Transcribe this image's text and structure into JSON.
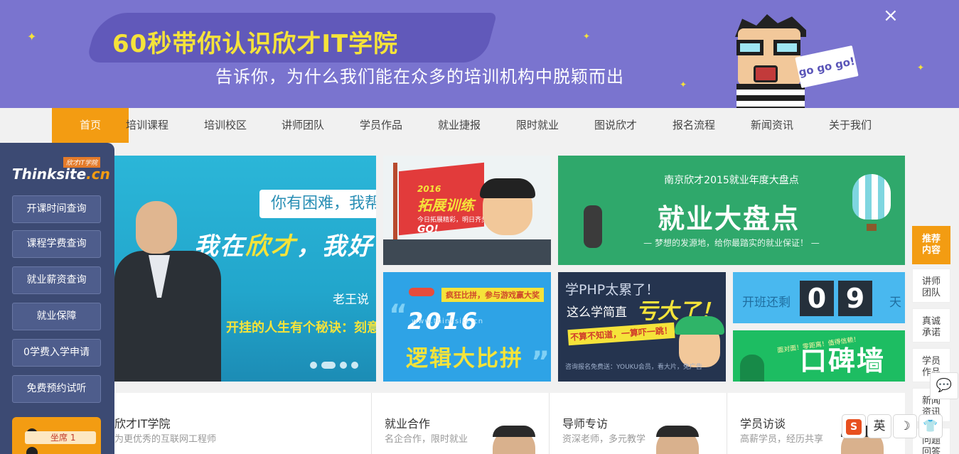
{
  "banner": {
    "title": "60秒带你认识欣才IT学院",
    "subtitle": "告诉你，为什么我们能在众多的培训机构中脱颖而出",
    "close": "×",
    "sign": "go go go!"
  },
  "nav": {
    "items": [
      "首页",
      "培训课程",
      "培训校区",
      "讲师团队",
      "学员作品",
      "就业捷报",
      "限时就业",
      "图说欣才",
      "报名流程",
      "新闻资讯",
      "关于我们"
    ]
  },
  "sidebar": {
    "logo_tag": "欣才IT学院",
    "logo_word": "Thinksite",
    "logo_suffix": ".cn",
    "buttons": [
      "开课时间查询",
      "课程学费查询",
      "就业薪资查询",
      "就业保障",
      "0学费入学申请",
      "免费预约试听"
    ],
    "qq_label": "坐席 1"
  },
  "slider": {
    "bubble": "你有困难，我帮",
    "headline_a": "我在",
    "headline_b": "欣才",
    "headline_c": "，我好",
    "byline": "老王说",
    "secret": "开挂的人生有个秘诀：刻意"
  },
  "tiles": {
    "outreach": {
      "year": "2016",
      "title": "拓展训练",
      "go": "GO!",
      "sub": "今日拓展精彩，明日齐步辉煌"
    },
    "review": {
      "small": "南京欣才2015就业年度大盘点",
      "big": "就业大盘点",
      "foot": "— 梦想的发源地，给你最踏实的就业保证！ —"
    },
    "contest": {
      "tag": "疯狂比拼，参与游戏赢大奖",
      "year": "2016",
      "url": "www.thinksite.cn",
      "title": "逻辑大比拼"
    },
    "php": {
      "l1": "学PHP太累了！",
      "l2": "这么学简直",
      "l3": "亏大了！",
      "bar": "不算不知道，一算吓一跳！",
      "foot": "咨询报名免费送：YOUKU会员，看大片，免广告"
    },
    "countdown": {
      "label": "开班还剩",
      "digits": [
        "0",
        "9"
      ],
      "unit": "天"
    },
    "wall": {
      "big": "口碑墙",
      "note": "面对面！零距离！值得信赖！"
    }
  },
  "cards": [
    {
      "title": "欣才IT学院",
      "sub": "为更优秀的互联网工程师"
    },
    {
      "title": "就业合作",
      "sub": "名企合作，限时就业"
    },
    {
      "title": "导师专访",
      "sub": "资深老师，多元教学"
    },
    {
      "title": "学员访谈",
      "sub": "高薪学员，经历共享"
    }
  ],
  "right_panel": {
    "items": [
      "推荐内容",
      "讲师团队",
      "真诚承诺",
      "学员作品",
      "新闻资讯",
      "问题回答"
    ]
  },
  "ime": {
    "logo": "S",
    "lang": "英",
    "moon": "☽",
    "skin": "👕"
  },
  "colors": {
    "accent": "#f39c12",
    "banner": "#7a74cf",
    "sidebar": "#3c4a73"
  }
}
